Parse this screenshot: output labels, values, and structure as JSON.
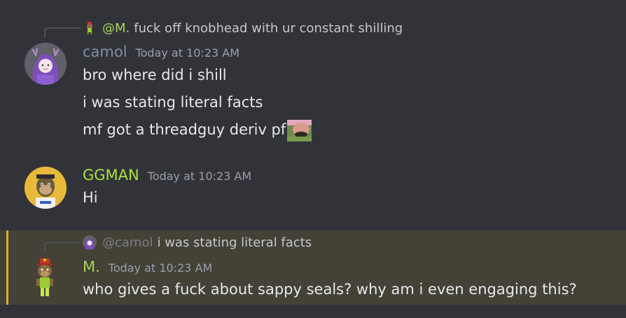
{
  "messages": [
    {
      "reply": {
        "mention": "@M.",
        "text": "fuck off knobhead with ur constant shilling"
      },
      "author": "camol",
      "timestamp": "Today at 10:23 AM",
      "lines": [
        "bro where did i shill",
        "i was stating literal facts",
        "mf got a threadguy deriv pfp"
      ]
    },
    {
      "author": "GGMAN",
      "timestamp": "Today at 10:23 AM",
      "lines": [
        "Hi"
      ]
    },
    {
      "reply": {
        "mention": "@camol",
        "text": "i was stating literal facts"
      },
      "author": "M.",
      "timestamp": "Today at 10:23 AM",
      "lines": [
        "who gives a fuck about sappy seals? why am i even engaging this?"
      ]
    }
  ],
  "colors": {
    "background": "#323339",
    "highlight_background": "#444137",
    "highlight_bar": "#e7a73c",
    "camol_name": "#7d8ea6",
    "ggman_name": "#a8e33a",
    "m_name": "#a4d65e"
  }
}
